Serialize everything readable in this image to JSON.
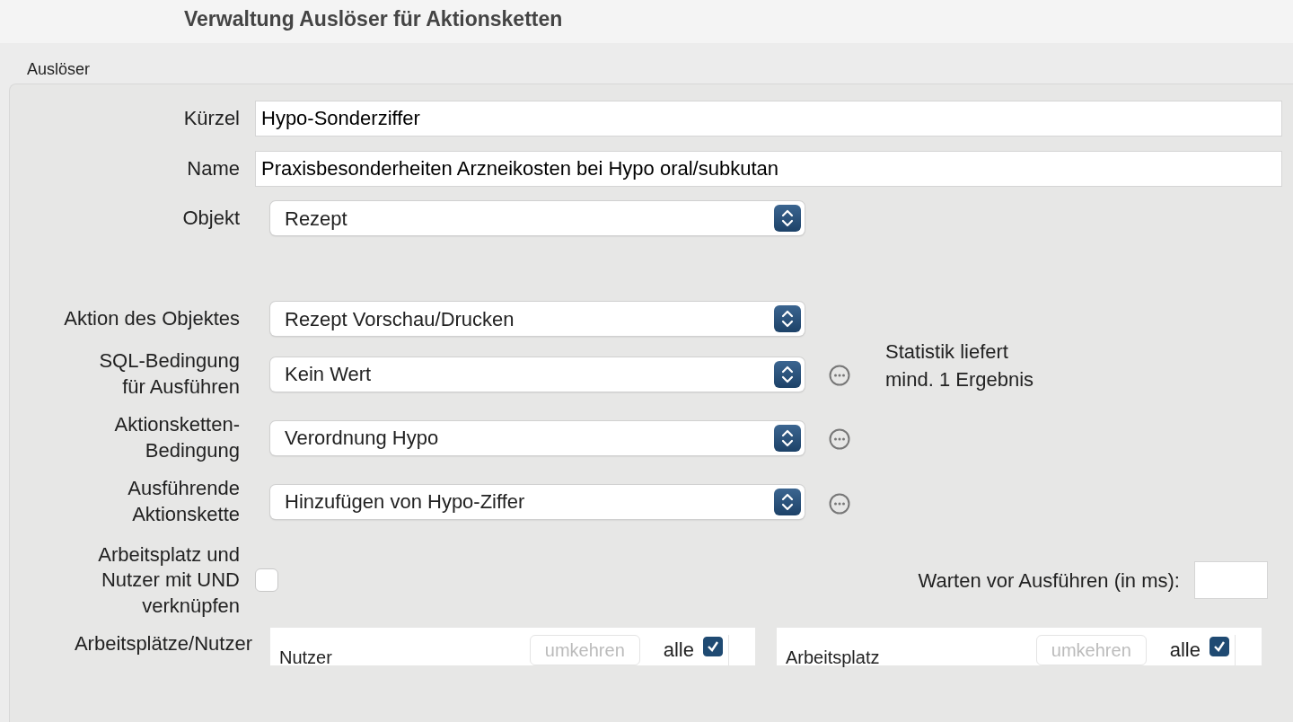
{
  "window": {
    "title": "Verwaltung Auslöser für Aktionsketten"
  },
  "section_label": "Auslöser",
  "identity": [
    {
      "kind": "text",
      "label": "Kürzel",
      "value": "Hypo-Sonderziffer"
    },
    {
      "kind": "text",
      "label": "Name",
      "value": "Praxisbesonderheiten Arzneikosten bei Hypo oral/subkutan"
    },
    {
      "kind": "select",
      "label": "Objekt",
      "value": "Rezept",
      "more_button": false
    }
  ],
  "execution": [
    {
      "kind": "select",
      "label": "Aktion des Objektes",
      "value": "Rezept Vorschau/Drucken",
      "more_button": false
    },
    {
      "kind": "select",
      "label": "SQL-Bedingung\nfür Ausführen",
      "value": "Kein Wert",
      "more_button": true,
      "note": "Statistik liefert\nmind. 1 Ergebnis"
    },
    {
      "kind": "select",
      "label": "Aktionsketten-\nBedingung",
      "value": "Verordnung Hypo",
      "more_button": true
    },
    {
      "kind": "select",
      "label": "Ausführende\nAktionskette",
      "value": "Hinzufügen von Hypo-Ziffer",
      "more_button": true
    }
  ],
  "and_link": {
    "label": "Arbeitsplatz und\nNutzer mit UND\nverknüpfen",
    "checked": false
  },
  "delay": {
    "label": "Warten vor Ausführen (in ms):"
  },
  "assignment": {
    "label": "Arbeitsplätze/Nutzer",
    "lists": [
      {
        "title": "Nutzer",
        "invert_button": "umkehren",
        "invert_disabled": true,
        "all_label": "alle",
        "all_checked": true
      },
      {
        "title": "Arbeitsplatz",
        "invert_button": "umkehren",
        "invert_disabled": true,
        "all_label": "alle",
        "all_checked": true
      }
    ]
  }
}
